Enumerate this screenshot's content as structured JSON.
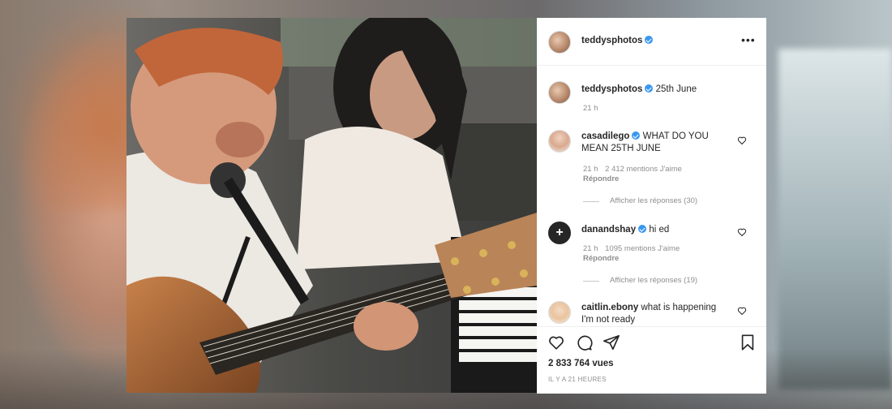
{
  "post": {
    "username": "teddysphotos",
    "caption": "25th June",
    "caption_time": "21 h"
  },
  "comments": [
    {
      "username": "casadilego",
      "text": "WHAT DO YOU MEAN 25TH JUNE",
      "time": "21 h",
      "likes": "2 412 mentions J'aime",
      "reply": "Répondre",
      "view_replies": "Afficher les réponses (30)"
    },
    {
      "username": "danandshay",
      "text": "hi ed",
      "time": "21 h",
      "likes": "1095 mentions J'aime",
      "reply": "Répondre",
      "view_replies": "Afficher les réponses (19)"
    },
    {
      "username": "caitlin.ebony",
      "text": "what is happening I'm not ready"
    }
  ],
  "footer": {
    "views": "2 833 764 vues",
    "posted": "IL Y A 21 HEURES"
  },
  "icons": {
    "more": "more-options-icon",
    "like": "heart-icon",
    "comment": "comment-icon",
    "share": "share-icon",
    "save": "bookmark-icon",
    "verified": "verified-badge-icon"
  },
  "colors": {
    "verified": "#3897f0",
    "secondary_text": "#8e8e8e",
    "primary_text": "#262626"
  }
}
